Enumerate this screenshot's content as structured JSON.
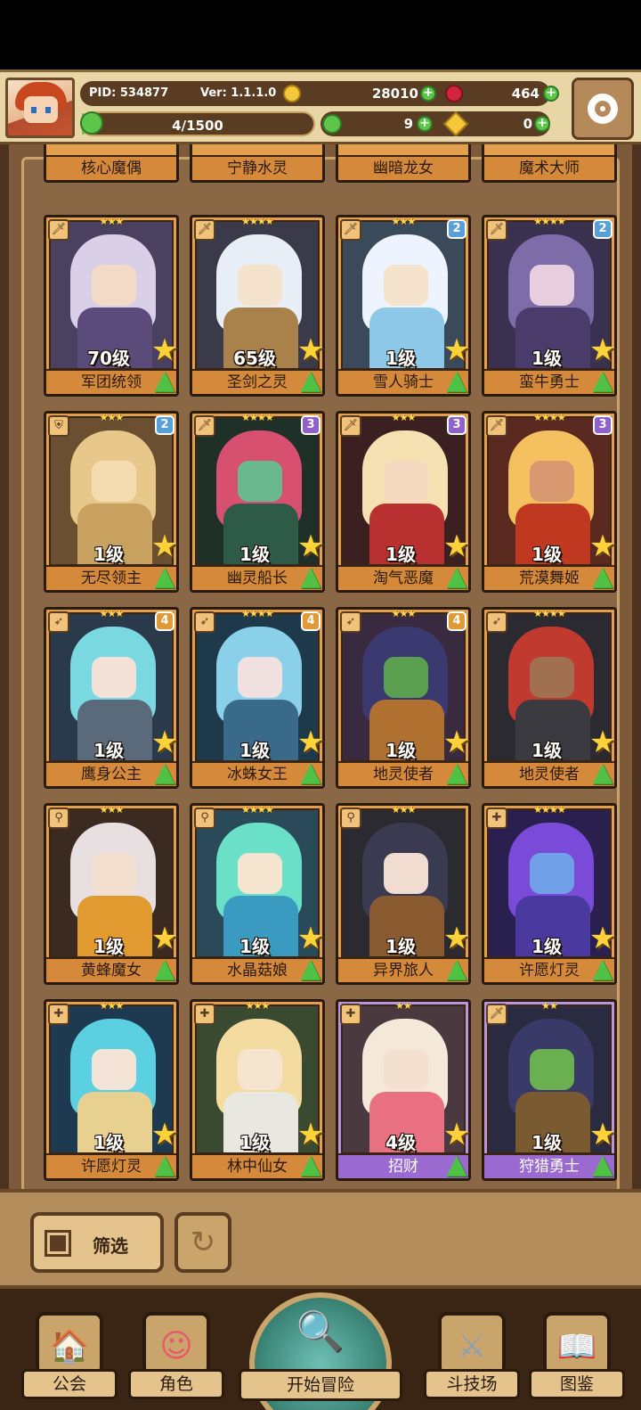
{
  "header": {
    "pid": "PID: 534877",
    "version": "Ver: 1.1.1.0",
    "gold": "28010",
    "gems": "464",
    "energy": "4/1500",
    "energy_fraction": 0.0027,
    "clovers": "9",
    "keys": "0"
  },
  "top_row_names": [
    "核心魔偶",
    "宁静水灵",
    "幽暗龙女",
    "魔术大师"
  ],
  "cards": [
    {
      "name": "军团统领",
      "level": "70级",
      "stars": "★★★",
      "tier": "",
      "class": "sword-icon",
      "palette": [
        "#4a4060",
        "#d9d0e8",
        "#f2dcc8",
        "#5a4b7a"
      ]
    },
    {
      "name": "圣剑之灵",
      "level": "65级",
      "stars": "★★★★",
      "tier": "",
      "class": "sword-icon",
      "palette": [
        "#3a3a4a",
        "#e8eef5",
        "#f4e2cc",
        "#a8824a"
      ]
    },
    {
      "name": "雪人骑士",
      "level": "1级",
      "stars": "★★★",
      "tier": "2",
      "class": "sword-icon",
      "palette": [
        "#3a4a5a",
        "#eef4ff",
        "#f4e2cc",
        "#8ec8e8"
      ]
    },
    {
      "name": "蛮牛勇士",
      "level": "1级",
      "stars": "★★★★",
      "tier": "2",
      "class": "sword-icon",
      "palette": [
        "#3a3050",
        "#7c6ca8",
        "#e8cfe0",
        "#4a3c6a"
      ]
    },
    {
      "name": "无尽领主",
      "level": "1级",
      "stars": "★★★",
      "tier": "2",
      "class": "shield-icon",
      "palette": [
        "#6a5030",
        "#e8c88a",
        "#f4dcb0",
        "#c8a060"
      ]
    },
    {
      "name": "幽灵船长",
      "level": "1级",
      "stars": "★★★★",
      "tier": "3",
      "class": "sword-icon",
      "palette": [
        "#1e3028",
        "#d85070",
        "#6ab890",
        "#2e5a48"
      ]
    },
    {
      "name": "淘气恶魔",
      "level": "1级",
      "stars": "★★★",
      "tier": "3",
      "class": "sword-icon",
      "palette": [
        "#3a2020",
        "#f4e0b0",
        "#f4d8c0",
        "#b83030"
      ]
    },
    {
      "name": "荒漠舞姬",
      "level": "1级",
      "stars": "★★★★",
      "tier": "3",
      "class": "sword-icon",
      "palette": [
        "#5a2a20",
        "#f4c060",
        "#d89870",
        "#c03820"
      ]
    },
    {
      "name": "鹰身公主",
      "level": "1级",
      "stars": "★★★",
      "tier": "4",
      "class": "bow-icon",
      "palette": [
        "#2a3a4a",
        "#7ad8e0",
        "#f4e2d8",
        "#5a6a7a"
      ]
    },
    {
      "name": "冰蛛女王",
      "level": "1级",
      "stars": "★★★★",
      "tier": "4",
      "class": "bow-icon",
      "palette": [
        "#1e3a4a",
        "#8ad0e8",
        "#f0e0e0",
        "#3a6a8a"
      ]
    },
    {
      "name": "地灵使者",
      "level": "1级",
      "stars": "★★★",
      "tier": "4",
      "class": "bow-icon",
      "palette": [
        "#3a2a40",
        "#3a3a70",
        "#5aa050",
        "#b07030"
      ]
    },
    {
      "name": "地灵使者",
      "level": "1级",
      "stars": "★★★★",
      "tier": "",
      "class": "bow-icon",
      "palette": [
        "#2a2a30",
        "#c03a30",
        "#a07050",
        "#3a3a40"
      ]
    },
    {
      "name": "黄蜂魔女",
      "level": "1级",
      "stars": "★★★",
      "tier": "",
      "class": "staff-icon",
      "palette": [
        "#3a2a20",
        "#e8e0e0",
        "#f4e0d0",
        "#e09a30"
      ]
    },
    {
      "name": "水晶菇娘",
      "level": "1级",
      "stars": "★★★★",
      "tier": "",
      "class": "staff-icon",
      "palette": [
        "#2a4a5a",
        "#6ae0c8",
        "#f4e4d0",
        "#3a9ac0"
      ]
    },
    {
      "name": "异界旅人",
      "level": "1级",
      "stars": "★★★",
      "tier": "",
      "class": "staff-icon",
      "palette": [
        "#2a2a30",
        "#3a3a50",
        "#f0dcd0",
        "#8a5a30"
      ]
    },
    {
      "name": "许愿灯灵",
      "level": "1级",
      "stars": "★★★★",
      "tier": "",
      "class": "cross-icon",
      "palette": [
        "#2a2050",
        "#7a4ad8",
        "#70a0e8",
        "#4a3aa0"
      ]
    },
    {
      "name": "许愿灯灵",
      "level": "1级",
      "stars": "★★★",
      "tier": "",
      "class": "cross-icon",
      "palette": [
        "#1e3a50",
        "#5ad0e0",
        "#f4e4d8",
        "#e8d090"
      ]
    },
    {
      "name": "林中仙女",
      "level": "1级",
      "stars": "★★★",
      "tier": "",
      "class": "cross-icon",
      "palette": [
        "#3a4a30",
        "#f4dca0",
        "#f4e4d0",
        "#e8e8e0"
      ]
    },
    {
      "name": "招财",
      "level": "4级",
      "stars": "★★",
      "tier": "",
      "class": "cross-icon",
      "purple": true,
      "palette": [
        "#4a3a40",
        "#f4e8d8",
        "#f4e0d0",
        "#e87080"
      ]
    },
    {
      "name": "狩猎勇士",
      "level": "1级",
      "stars": "★★",
      "tier": "",
      "class": "sword-icon",
      "purple": true,
      "palette": [
        "#2a2a40",
        "#3a3a68",
        "#6ab050",
        "#7a5a30"
      ]
    }
  ],
  "controls": {
    "filter_label": "筛选"
  },
  "nav": {
    "guild": "公会",
    "characters": "角色",
    "adventure": "开始冒险",
    "arena": "斗技场",
    "codex": "图鉴"
  }
}
